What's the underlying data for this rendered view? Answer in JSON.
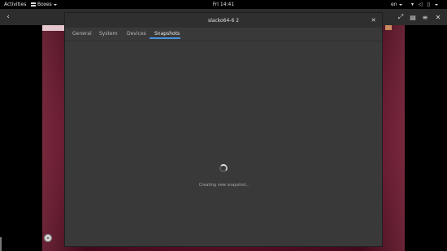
{
  "topbar": {
    "activities": "Activities",
    "app_menu": "Boxes",
    "clock": "Fri 14:41",
    "language": "en",
    "status_icons": [
      "network-icon",
      "volume-icon",
      "battery-icon"
    ]
  },
  "boxes_header": {
    "back_icon": "back-arrow-icon",
    "right_buttons": [
      "fullscreen-icon",
      "properties-icon",
      "menu-icon",
      "close-icon"
    ]
  },
  "dialog": {
    "title": "slacko64-6 2",
    "tabs": [
      {
        "label": "General",
        "active": false
      },
      {
        "label": "System",
        "active": false
      },
      {
        "label": "Devices",
        "active": false
      },
      {
        "label": "Snapshots",
        "active": true
      }
    ],
    "status_text": "Creating new snapshot...",
    "accent_color": "#4a90d9"
  },
  "colors": {
    "vm_background": "#6d1733",
    "dialog_background": "#393939",
    "topbar_background": "#000000"
  }
}
